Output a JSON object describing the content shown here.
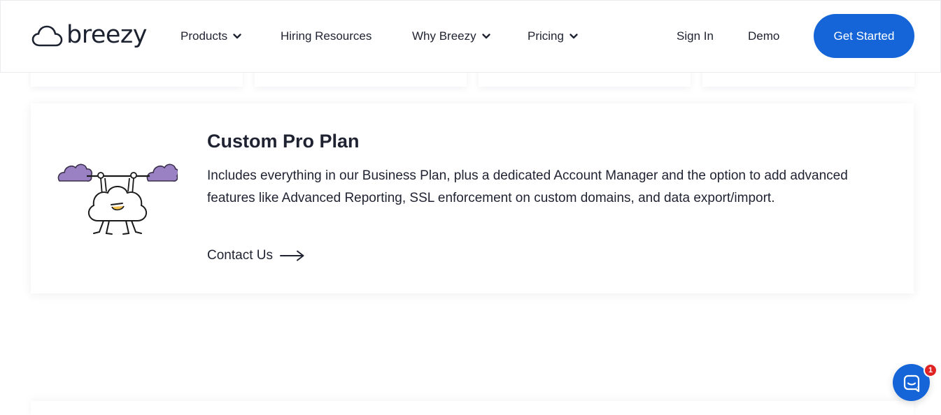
{
  "brand": {
    "name": "breezy",
    "accent_color": "#1565d8",
    "logo_icon": "cloud-icon"
  },
  "nav": {
    "items": [
      {
        "label": "Products",
        "has_dropdown": true
      },
      {
        "label": "Hiring Resources",
        "has_dropdown": false
      },
      {
        "label": "Why Breezy",
        "has_dropdown": true
      },
      {
        "label": "Pricing",
        "has_dropdown": true
      }
    ],
    "sign_in": "Sign In",
    "demo": "Demo",
    "cta": "Get Started"
  },
  "plan": {
    "title": "Custom Pro Plan",
    "description": "Includes everything in our Business Plan, plus a dedicated Account Manager and the option to add advanced features like Advanced Reporting, SSL enforcement on custom domains, and data export/import.",
    "link_label": "Contact Us",
    "illustration": "cloud-weightlifter-illustration"
  },
  "chat": {
    "icon": "chat-bubble-icon",
    "badge_count": "1",
    "badge_color": "#e02424"
  }
}
